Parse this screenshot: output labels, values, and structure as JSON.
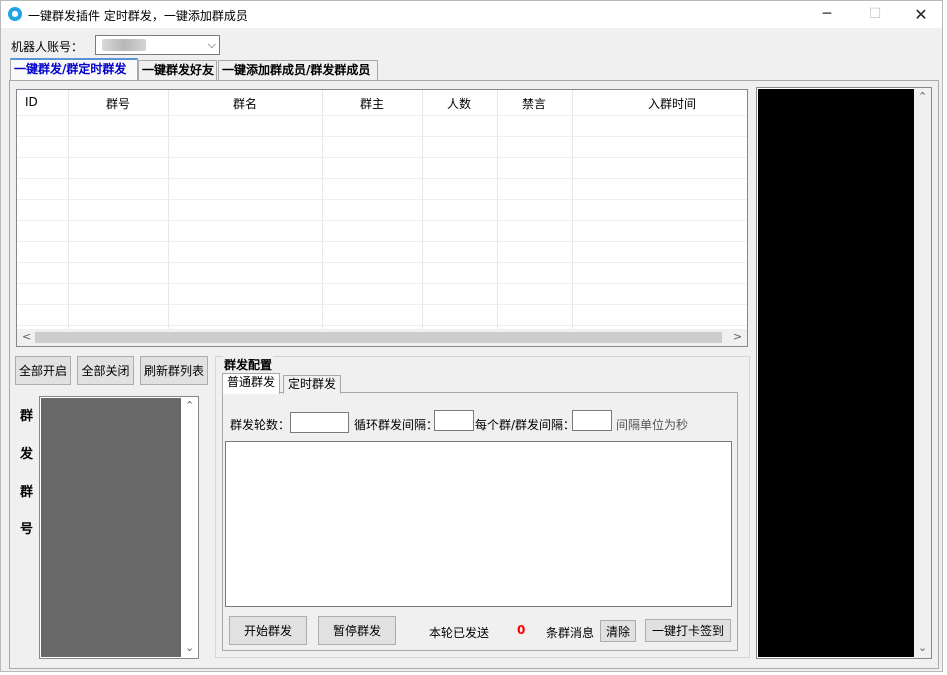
{
  "window": {
    "title": "一键群发插件  定时群发，一键添加群成员",
    "icon": "app-bubble-icon",
    "controls": {
      "minimize": "─",
      "maximize": "☐",
      "close": "✕"
    }
  },
  "robot_account": {
    "label": "机器人账号：",
    "selected_value": ""
  },
  "tabs": [
    {
      "label": "一键群发/群定时群发",
      "active": true
    },
    {
      "label": "一键群发好友",
      "active": false
    },
    {
      "label": "一键添加群成员/群发群成员",
      "active": false
    }
  ],
  "group_table": {
    "columns": [
      "ID",
      "群号",
      "群名",
      "群主",
      "人数",
      "禁言",
      "入群时间"
    ],
    "rows": []
  },
  "actions": {
    "enable_all": "全部开启",
    "disable_all": "全部关闭",
    "refresh_groups": "刷新群列表"
  },
  "group_list_label": [
    "群",
    "发",
    "群",
    "号"
  ],
  "config": {
    "title": "群发配置",
    "subtabs": [
      {
        "label": "普通群发",
        "active": true
      },
      {
        "label": "定时群发",
        "active": false
      }
    ],
    "rounds_label": "群发轮数：",
    "rounds_value": "",
    "loop_interval_label": "循环群发间隔：",
    "loop_interval_value": "",
    "per_group_interval_label": "每个群/群发间隔：",
    "per_group_interval_value": "",
    "unit_note": "间隔单位为秒",
    "message_text": "",
    "start_button": "开始群发",
    "pause_button": "暂停群发",
    "sent_label": "本轮已发送",
    "sent_count": "0",
    "messages_label": "条群消息",
    "clear_button": "清除",
    "checkin_button": "一键打卡签到"
  },
  "colors": {
    "active_tab": "#0000cc",
    "count": "#ff0000",
    "log_panel": "#000000",
    "group_list": "#696969"
  }
}
